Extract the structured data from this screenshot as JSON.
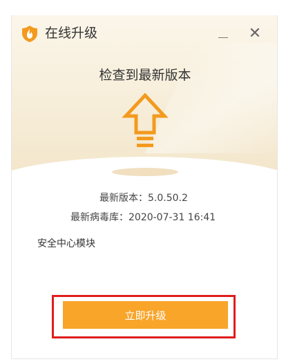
{
  "window": {
    "title": "在线升级",
    "minimize_icon": "minimize-icon",
    "close_glyph": "✕"
  },
  "headline": "检查到最新版本",
  "hero_icon": "upgrade-arrow-icon",
  "info": {
    "version_label": "最新版本：",
    "version_value": "5.0.50.2",
    "virus_db_label": "最新病毒库：",
    "virus_db_value": "2020-07-31 16:41"
  },
  "module_label": "安全中心模块",
  "upgrade_button_label": "立即升级",
  "colors": {
    "accent": "#f8a52a",
    "highlight_border": "#e01c1c",
    "logo_orange": "#f39a1e"
  }
}
